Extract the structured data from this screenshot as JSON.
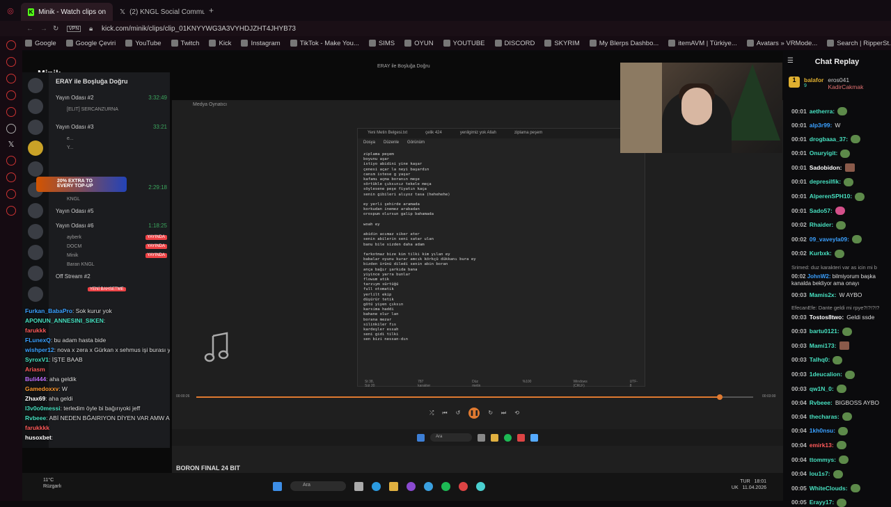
{
  "browser": {
    "tabs": [
      {
        "label": "Minik - Watch clips on",
        "active": true
      },
      {
        "label": "(2) KNGL Social Communi",
        "active": false
      }
    ],
    "url": "kick.com/minik/clips/clip_01KNYYWG3A3VYHDJZHT4JHYB73",
    "bookmarks": [
      "Google",
      "Google Çeviri",
      "YouTube",
      "Twitch",
      "Kick",
      "Instagram",
      "TikTok - Make You...",
      "SIMS",
      "OYUN",
      "YOUTUBE",
      "DISCORD",
      "SKYRIM",
      "My Blerps Dashbo...",
      "itemAVM | Türkiye...",
      "Avatars » VRMode...",
      "Search | RipperSt..."
    ]
  },
  "stream": {
    "channel_title": "Minik",
    "overlay_caption": "ERAY ile Boşluğa Doğru",
    "discord": {
      "server_name": "ERAY ile Boşluğa Doğru",
      "promo": "20% EXTRA TO EVERY TOP-UP",
      "channels": [
        {
          "name": "Yayın Odası #2",
          "time": "3:32:49",
          "users": [
            "[ELIT] SERCANZURNA"
          ]
        },
        {
          "name": "Yayın Odası #3",
          "time": "33:21",
          "users": [
            "e...",
            "Y..."
          ]
        },
        {
          "name": "Yayın Odası #4",
          "time": "2:29:18",
          "users": [
            "KNGL"
          ]
        },
        {
          "name": "Yayın Odası #5",
          "time": "",
          "users": []
        },
        {
          "name": "Yayın Odası #6",
          "time": "1:18:25",
          "users": [
            "ayberk",
            "DOCM",
            "Minik",
            "Baran KNGL"
          ]
        },
        {
          "name": "Off Stream #2",
          "time": "",
          "users": []
        }
      ],
      "live_label": "YAYINDA",
      "new_stream_label": "YENİ BAHSETME"
    },
    "overlay_chat": [
      {
        "user": "Furkan_BabaPro",
        "text": ": Sok kurur yok",
        "color": "#3aa0ff"
      },
      {
        "user": "APONUN_ANNESINI_SIKEN",
        "text": ":",
        "color": "#47e0c0"
      },
      {
        "user": "farukkk",
        "text": "",
        "color": "#ff5a5a"
      },
      {
        "user": "FLunexQ",
        "text": ": bu adam hasta bide",
        "color": "#3aa0ff"
      },
      {
        "user": "wishper12",
        "text": ": nova x zera x Gürkan x sehmus işi burası ya",
        "color": "#3aa0ff"
      },
      {
        "user": "SyroxV1",
        "text": ": İŞTE BAAB",
        "color": "#47e0c0"
      },
      {
        "user": "Ariasm",
        "text": "",
        "color": "#ff5a5a"
      },
      {
        "user": "Buli444",
        "text": ": aha geldik",
        "color": "#c070ff"
      },
      {
        "user": "Gamedoxxv",
        "text": ": W",
        "color": "#ff9a30"
      },
      {
        "user": "Zhax69",
        "text": ": aha geldi",
        "color": "#ffffff"
      },
      {
        "user": "l3v0o0messi",
        "text": ": terledim öyle bi bağırıyoki jeff",
        "color": "#47e0c0"
      },
      {
        "user": "Rvbeee",
        "text": ": ABİ NEDEN BĞAIRIYON DİYEN VAR AMW AOSIHDJUSAUDIOOUIASHDASUDSIJDADSAPOI,",
        "color": "#47e0c0"
      },
      {
        "user": "farukkkk",
        "text": "",
        "color": "#ff5a5a"
      },
      {
        "user": "husoxbet",
        "text": ":",
        "color": "#ffffff"
      }
    ],
    "player": {
      "window_title": "Medya Oynatıcı",
      "track": "BORON FINAL 24 BIT",
      "elapsed": "00:00:26",
      "duration": "00:03:00",
      "progress": 0.94
    },
    "notepad": {
      "tabs": [
        "Yeni Metin Belgesi.txt",
        "çelik 424",
        "yenilgimiz yok Allah",
        "ziplama peşem"
      ],
      "menu": [
        "Dosya",
        "Düzenle",
        "Görünüm"
      ],
      "lines": [
        "ziplama peşem",
        "boyunu aşar",
        "istiyo abidini yine kaşar",
        "çenesi açar la neyi başardın",
        "canım istese g yaşar",
        "kafamı açma boranın meşe",
        "sörtükle çıksınız tekele meça",
        "söylesene peşe fiyatın kaça",
        "senin gibileri alıyoz tasa (hehehehe)",
        "",
        "ey yerli şehirde aramada",
        "korkudan inemez arabadan",
        "orospum olursun galip bahamada",
        "",
        "woah ey",
        "",
        "abidin acımaz siker ater",
        "senin abilerin seni satar ulan",
        "banu bile sizden daha adam",
        "",
        "farkotmaz bize kim tilki kim yılan ey",
        "babalar oyunu kurar amcık körkçü dükkanı bura ey",
        "bizden ürünü diledi senin abin boran",
        "ança bağır şarkıda bana",
        "yiyince yarra bunlar",
        "flowum atik",
        "tarzıym sürtüğü",
        "full otomatik",
        "yerlilt ekip",
        "düşürür tetik",
        "götü yiyen çıksın",
        "karsima haddi",
        "bahane olur lan",
        "borana mezar",
        "silinkiler fıs",
        "kardeşler essah",
        "seni gidi tilki",
        "sen bizi nessan-dın"
      ],
      "status": [
        "St 38, Süt 20",
        "787 karakter",
        "Düz metin",
        "%100",
        "Windows (CRLF)",
        "UTF-8"
      ]
    },
    "inner_taskbar": {
      "search_placeholder": "Ara"
    },
    "taskbar": {
      "weather_temp": "11°C",
      "weather_desc": "Rüzgarlı",
      "search_placeholder": "Ara",
      "lang": "TUR",
      "lang2": "UK",
      "time": "18:01",
      "date": "11.04.2026"
    }
  },
  "chat_replay": {
    "title": "Chat Replay",
    "pinned": [
      {
        "user": "balafor",
        "level": "9"
      },
      {
        "user": "eros041"
      },
      {
        "user": "KadirCakmak"
      }
    ],
    "messages": [
      {
        "t": "00:01",
        "user": "aetherra:",
        "text": "",
        "color": "#47e0c0",
        "emote": "green"
      },
      {
        "t": "00:01",
        "user": "alp3r99:",
        "text": "W",
        "color": "#3aa0ff"
      },
      {
        "t": "00:01",
        "user": "drogbaaa_37:",
        "text": "",
        "color": "#47e0c0",
        "emote": "green"
      },
      {
        "t": "00:01",
        "user": "Onuryigit:",
        "text": "",
        "color": "#47e0c0",
        "emote": "green"
      },
      {
        "t": "00:01",
        "user": "Sadobidon:",
        "text": "",
        "color": "#ffffff",
        "emote": "brown"
      },
      {
        "t": "00:01",
        "user": "depresilfik:",
        "text": "",
        "color": "#47e0c0",
        "emote": "green"
      },
      {
        "t": "00:01",
        "user": "AlperenSPH10:",
        "text": "",
        "color": "#47e0c0",
        "emote": "green"
      },
      {
        "t": "00:01",
        "user": "Sado57:",
        "text": "",
        "color": "#47e0c0",
        "emote": "pink"
      },
      {
        "t": "00:02",
        "user": "Rhaider:",
        "text": "",
        "color": "#47e0c0",
        "emote": "green"
      },
      {
        "t": "00:02",
        "user": "09_vaveyla09:",
        "text": "",
        "color": "#3aa0ff",
        "emote": "green"
      },
      {
        "t": "00:02",
        "user": "Kurbxk:",
        "text": "",
        "color": "#47e0c0",
        "emote": "green"
      }
    ],
    "reply1": {
      "sys": "Srimed: duz karakteri var as icin mi b",
      "t": "00:02",
      "user": "JohnW2:",
      "text": "bilmiyorum başka kanalda bekliyor ama onayı",
      "color": "#3aa0ff"
    },
    "messages2": [
      {
        "t": "00:03",
        "user": "Mamis2x:",
        "text": "W AYBO",
        "color": "#47e0c0"
      }
    ],
    "reply2": {
      "sys": "EfecanEfe: Dante geldi mi rpye?!?!?!?",
      "t": "00:03",
      "user": "Tostos8two:",
      "text": "Geldi ssde",
      "color": "#ffffff"
    },
    "messages3": [
      {
        "t": "00:03",
        "user": "bartu0121:",
        "text": "",
        "color": "#47e0c0",
        "emote": "green"
      },
      {
        "t": "00:03",
        "user": "Mami173:",
        "text": "",
        "color": "#47e0c0",
        "emote": "brown"
      },
      {
        "t": "00:03",
        "user": "Talhq0:",
        "text": "",
        "color": "#47e0c0",
        "emote": "green"
      },
      {
        "t": "00:03",
        "user": "1deucalion:",
        "text": "",
        "color": "#47e0c0",
        "emote": "green"
      },
      {
        "t": "00:03",
        "user": "qw1N_0:",
        "text": "",
        "color": "#47e0c0",
        "emote": "green"
      },
      {
        "t": "00:04",
        "user": "Rvbeee:",
        "text": "BIGBOSS AYBO",
        "color": "#47e0c0"
      },
      {
        "t": "00:04",
        "user": "thecharas:",
        "text": "",
        "color": "#47e0c0",
        "emote": "green"
      },
      {
        "t": "00:04",
        "user": "1kh0nsu:",
        "text": "",
        "color": "#3aa0ff",
        "emote": "green"
      },
      {
        "t": "00:04",
        "user": "emirk13:",
        "text": "",
        "color": "#ff5a5a",
        "emote": "green"
      },
      {
        "t": "00:04",
        "user": "ttommys:",
        "text": "",
        "color": "#47e0c0",
        "emote": "green"
      },
      {
        "t": "00:04",
        "user": "lou1s7:",
        "text": "",
        "color": "#47e0c0",
        "emote": "green"
      },
      {
        "t": "00:05",
        "user": "WhiteClouds:",
        "text": "",
        "color": "#47e0c0",
        "emote": "green"
      },
      {
        "t": "00:05",
        "user": "Erayy17:",
        "text": "",
        "color": "#47e0c0",
        "emote": "green"
      }
    ]
  }
}
